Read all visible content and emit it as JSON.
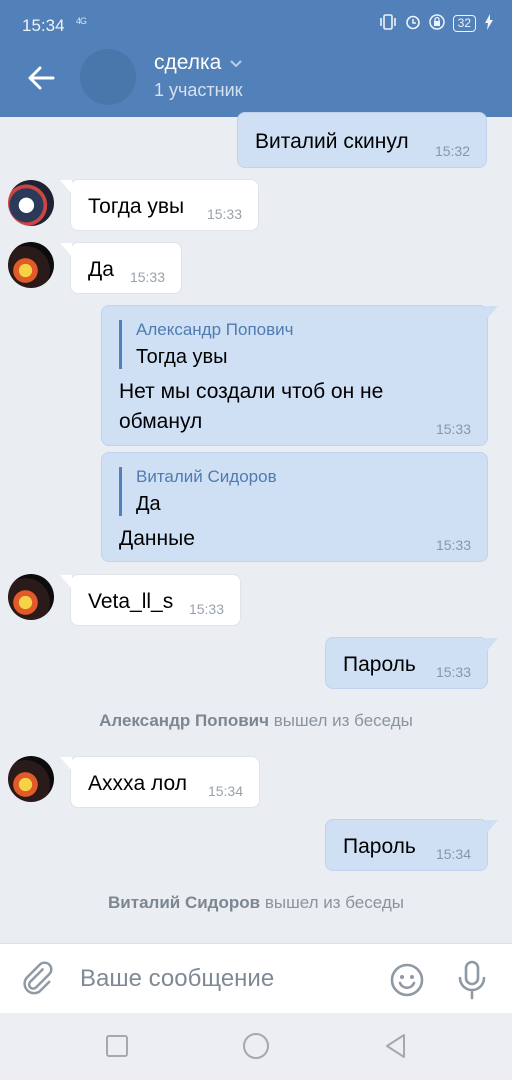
{
  "status": {
    "time": "15:34",
    "network": "4G",
    "battery": "32"
  },
  "header": {
    "title": "сделка",
    "subtitle": "1 участник"
  },
  "messages": [
    {
      "text": "Виталий скинул",
      "time": "15:32"
    },
    {
      "text": "Тогда увы",
      "time": "15:33"
    },
    {
      "text": "Да",
      "time": "15:33"
    },
    {
      "quote_name": "Александр Попович",
      "quote_text": "Тогда увы",
      "text_line1": "Нет мы создали чтоб он не",
      "text_line2": "обманул",
      "time": "15:33"
    },
    {
      "quote_name": "Виталий Сидоров",
      "quote_text": "Да",
      "text": "Данные",
      "time": "15:33"
    },
    {
      "text": "Veta_ll_s",
      "time": "15:33"
    },
    {
      "text": "Пароль",
      "time": "15:33"
    },
    {
      "text": "Аxxxa лол",
      "time": "15:34"
    },
    {
      "text": "Пароль",
      "time": "15:34"
    }
  ],
  "service": [
    {
      "name": "Александр Попович",
      "action": "вышел из беседы"
    },
    {
      "name": "Виталий Сидоров",
      "action": "вышел из беседы"
    }
  ],
  "composer": {
    "placeholder": "Ваше сообщение"
  },
  "colors": {
    "header": "#5181b8",
    "outgoing": "#cfe0f5",
    "incoming": "#ffffff",
    "background": "#eaedf1"
  }
}
